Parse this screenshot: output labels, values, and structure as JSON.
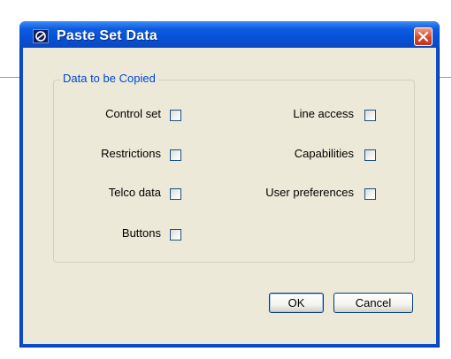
{
  "dialog": {
    "title": "Paste Set Data",
    "icon": "app-icon",
    "close_icon": "close-icon"
  },
  "group": {
    "legend": "Data to be Copied",
    "left_options": [
      {
        "label": "Control set",
        "checked": false
      },
      {
        "label": "Restrictions",
        "checked": false
      },
      {
        "label": "Telco data",
        "checked": false
      },
      {
        "label": "Buttons",
        "checked": false
      }
    ],
    "right_options": [
      {
        "label": "Line access",
        "checked": false
      },
      {
        "label": "Capabilities",
        "checked": false
      },
      {
        "label": "User preferences",
        "checked": false
      }
    ]
  },
  "buttons": {
    "ok": "OK",
    "cancel": "Cancel"
  },
  "colors": {
    "title_bar": "#0a4ec8",
    "dialog_face": "#ece9d8",
    "legend_text": "#0046d5",
    "close_button": "#d9452a"
  }
}
